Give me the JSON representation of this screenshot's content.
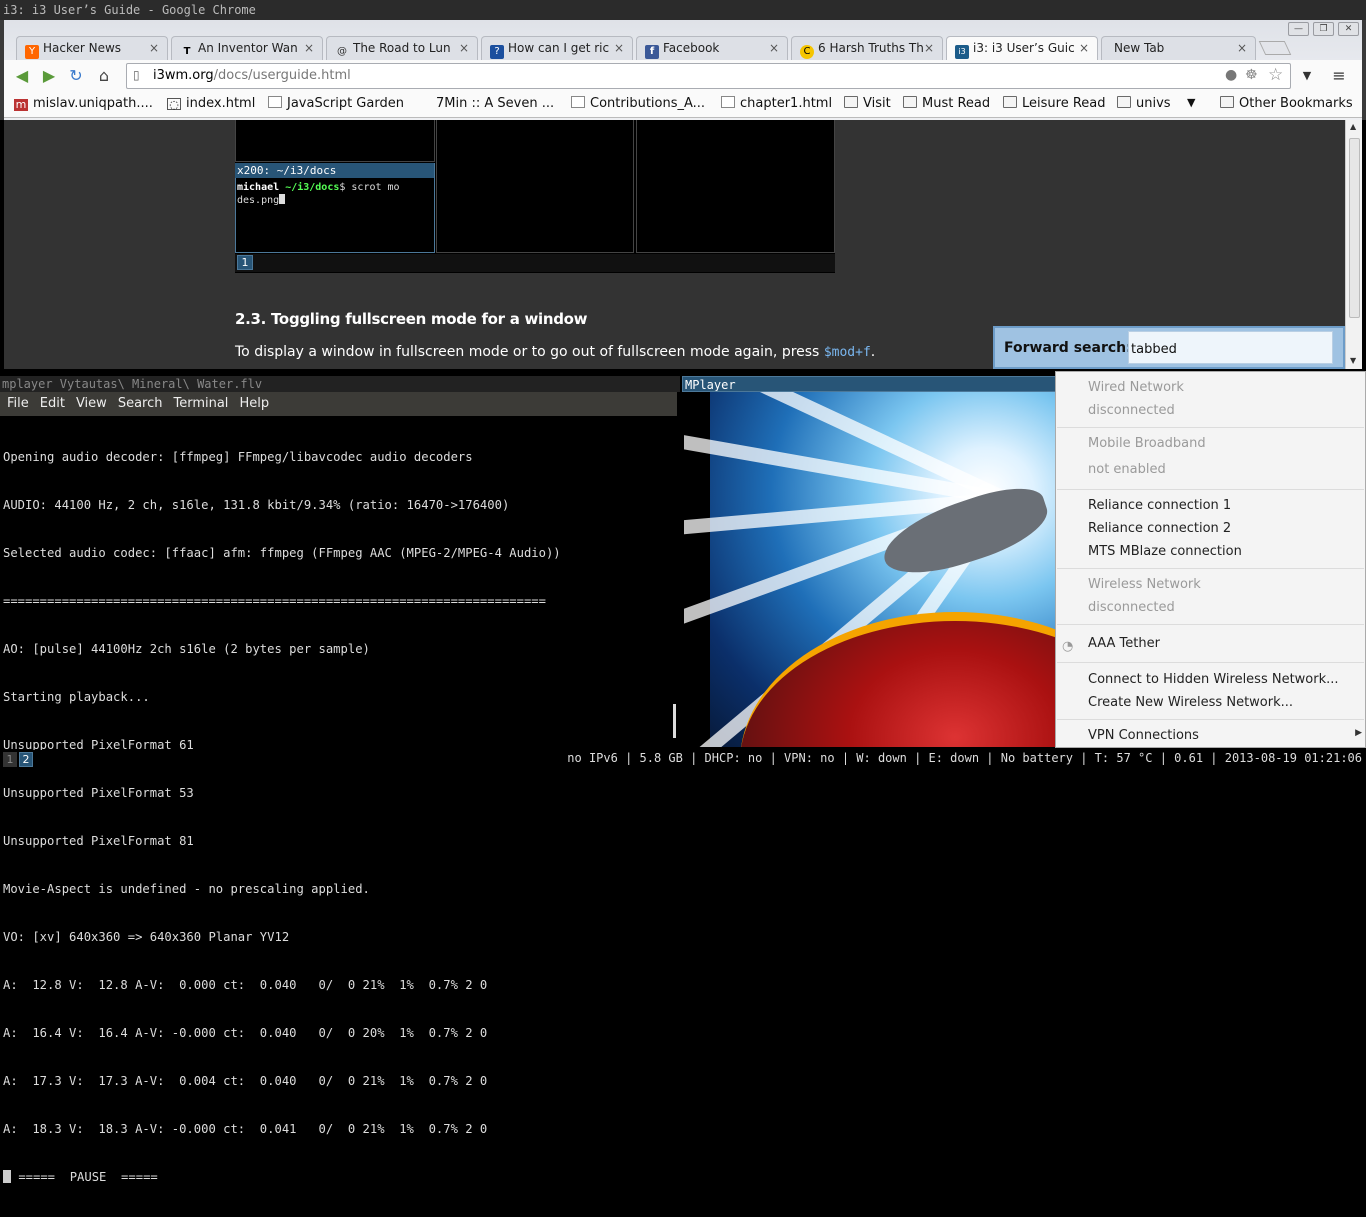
{
  "window_title": "i3: i3 User’s Guide - Google Chrome",
  "browser": {
    "tabs": [
      {
        "label": "Hacker News",
        "icon": "Y"
      },
      {
        "label": "An Inventor Wan",
        "icon": "T"
      },
      {
        "label": "The Road to Lun",
        "icon": "@"
      },
      {
        "label": "How can I get ric",
        "icon": "?"
      },
      {
        "label": "Facebook",
        "icon": "f"
      },
      {
        "label": "6 Harsh Truths Th",
        "icon": "C"
      },
      {
        "label": "i3: i3 User’s Guic",
        "icon": "i3"
      },
      {
        "label": "New Tab",
        "icon": ""
      }
    ],
    "tab_close": "×",
    "url_host": "i3wm.org",
    "url_path": "/docs/userguide.html",
    "bookmarks": [
      {
        "label": "mislav.uniqpath...."
      },
      {
        "label": "index.html"
      },
      {
        "label": "JavaScript Garden"
      },
      {
        "label": "7Min :: A Seven ..."
      },
      {
        "label": "Contributions_A..."
      },
      {
        "label": "chapter1.html"
      },
      {
        "label": "Visit"
      },
      {
        "label": "Must Read"
      },
      {
        "label": "Leisure Read"
      },
      {
        "label": "univs"
      },
      {
        "label": "Other Bookmarks"
      }
    ]
  },
  "page": {
    "mini_pane_title": "x200: ~/i3/docs",
    "mini_prompt_user": "michael",
    "mini_prompt_dir": "~/i3/docs",
    "mini_prompt_cmd": "$ scrot mo",
    "mini_prompt_cmd2": "des.png",
    "mini_workspace": "1",
    "section_heading": "2.3. Toggling fullscreen mode for a window",
    "paragraph": "To display a window in fullscreen mode or to go out of fullscreen mode again, press ",
    "paragraph_code": "$mod+f",
    "paragraph_end": ".",
    "forward_search_label": "Forward search: ?",
    "forward_search_value": "tabbed"
  },
  "terminal": {
    "title": "mplayer Vytautas\\ Mineral\\ Water.flv",
    "menu": [
      "File",
      "Edit",
      "View",
      "Search",
      "Terminal",
      "Help"
    ],
    "lines": [
      "Opening audio decoder: [ffmpeg] FFmpeg/libavcodec audio decoders",
      "AUDIO: 44100 Hz, 2 ch, s16le, 131.8 kbit/9.34% (ratio: 16470->176400)",
      "Selected audio codec: [ffaac] afm: ffmpeg (FFmpeg AAC (MPEG-2/MPEG-4 Audio))",
      "==========================================================================",
      "AO: [pulse] 44100Hz 2ch s16le (2 bytes per sample)",
      "Starting playback...",
      "Unsupported PixelFormat 61",
      "Unsupported PixelFormat 53",
      "Unsupported PixelFormat 81",
      "Movie-Aspect is undefined - no prescaling applied.",
      "VO: [xv] 640x360 => 640x360 Planar YV12",
      "A:  12.8 V:  12.8 A-V:  0.000 ct:  0.040   0/  0 21%  1%  0.7% 2 0",
      "A:  16.4 V:  16.4 A-V: -0.000 ct:  0.040   0/  0 20%  1%  0.7% 2 0",
      "A:  17.3 V:  17.3 A-V:  0.004 ct:  0.040   0/  0 21%  1%  0.7% 2 0",
      "A:  18.3 V:  18.3 A-V: -0.000 ct:  0.041   0/  0 21%  1%  0.7% 2 0"
    ],
    "pause_line": " =====  PAUSE  ====="
  },
  "mplayer": {
    "title": "MPlayer"
  },
  "network_menu": {
    "wired_header": "Wired Network",
    "wired_status": "disconnected",
    "mobile_header": "Mobile Broadband",
    "mobile_status": "not enabled",
    "connections": [
      "Reliance connection 1",
      "Reliance connection 2",
      "MTS MBlaze connection"
    ],
    "wireless_header": "Wireless Network",
    "wireless_status": "disconnected",
    "wifi_network": "AAA Tether",
    "hidden_network": "Connect to Hidden Wireless Network...",
    "new_network": "Create New Wireless Network...",
    "vpn": "VPN Connections"
  },
  "bottom_bar": {
    "workspaces": [
      "1",
      "2"
    ],
    "status": "no IPv6 | 5.8 GB | DHCP: no | VPN: no | W: down | E: down | No battery | T: 57 °C | 0.61 | 2013-08-19 01:21:06"
  },
  "colors": {
    "focus_blue": "#285577",
    "terminal_bg": "#000000",
    "page_bg": "#333333"
  }
}
